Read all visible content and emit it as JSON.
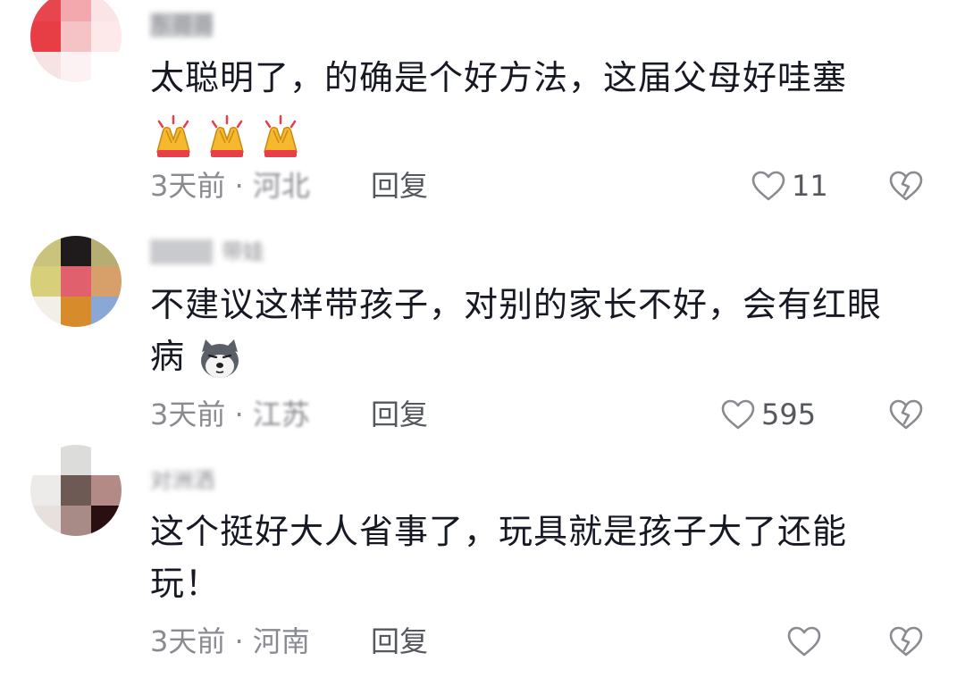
{
  "comments": [
    {
      "avatar_colors": [
        "#e8464e",
        "#f2a8ad",
        "#fbe4e6",
        "#e63e44",
        "#f5c2c6",
        "#fde9ea",
        "#f7e3e4",
        "#fdf2f3",
        "#ffffff"
      ],
      "username": "东哥哥",
      "text": "太聪明了，的确是个好方法，这届父母好哇塞",
      "emoji": [
        "clapping-hands",
        "clapping-hands",
        "clapping-hands"
      ],
      "time": "3天前",
      "separator": " · ",
      "location": "河北",
      "reply_label": "回复",
      "like_count": "11"
    },
    {
      "avatar_colors": [
        "#c9c37e",
        "#1f1b1d",
        "#b5ad72",
        "#d8cf7a",
        "#e0606d",
        "#d7a06a",
        "#f2f0e6",
        "#d78b2a",
        "#8aa7d6"
      ],
      "username": "带娃",
      "text": "不建议这样带孩子，对别的家长不好，会有红眼病",
      "emoji": [
        "husky-face"
      ],
      "time": "3天前",
      "separator": " · ",
      "location": "江苏",
      "reply_label": "回复",
      "like_count": "595"
    },
    {
      "avatar_colors": [
        "#ffffff",
        "#dcdcda",
        "#ffffff",
        "#ecebea",
        "#6e5a55",
        "#b48a86",
        "#e8e0dc",
        "#a88a86",
        "#2a0f12"
      ],
      "username": "对洲洒",
      "text": "这个挺好大人省事了，玩具就是孩子大了还能玩！",
      "emoji": [],
      "time": "3天前",
      "separator": " · ",
      "location": "河南",
      "reply_label": "回复",
      "like_count": ""
    }
  ],
  "colors": {
    "primary_text": "#161823",
    "secondary_text": "#8a8b91",
    "icon_gray": "#8a8b91"
  }
}
